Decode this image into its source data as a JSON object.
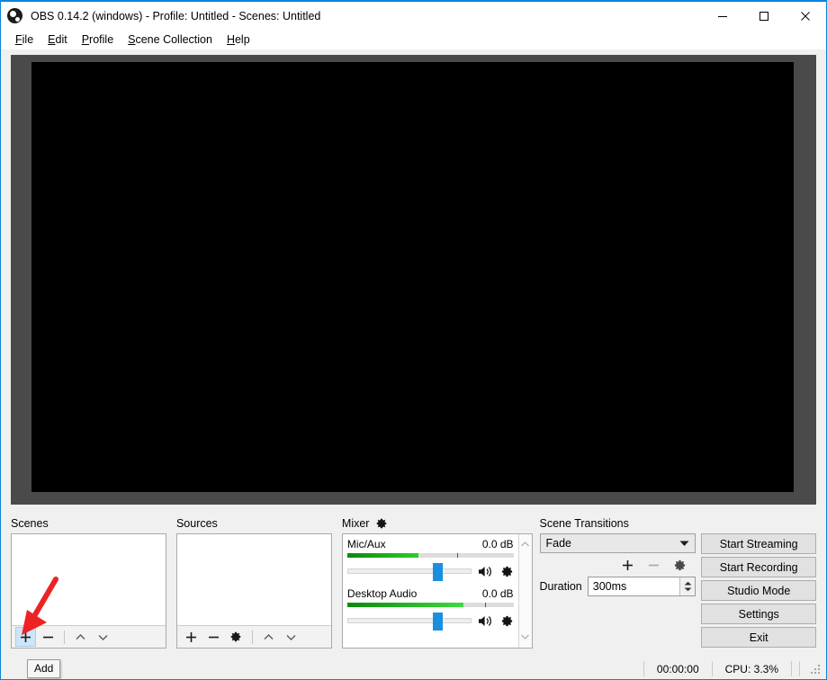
{
  "window": {
    "title": "OBS 0.14.2 (windows) - Profile: Untitled - Scenes: Untitled",
    "logo_icon": "obs-logo-icon",
    "minimize_label": "—",
    "maximize_label": "□",
    "close_label": "✕"
  },
  "menubar": {
    "items": [
      {
        "accel": "F",
        "rest": "ile"
      },
      {
        "accel": "E",
        "rest": "dit"
      },
      {
        "accel": "P",
        "rest": "rofile"
      },
      {
        "accel": "S",
        "rest": "cene Collection"
      },
      {
        "accel": "H",
        "rest": "elp"
      }
    ]
  },
  "preview": {
    "background_color": "#000000",
    "frame_color": "#4a4a4a"
  },
  "scenes": {
    "title": "Scenes",
    "items": [],
    "buttons": {
      "add": "+",
      "remove": "−",
      "up": "⌃",
      "down": "⌄"
    },
    "tooltip": "Add",
    "hovered_button": "add"
  },
  "sources": {
    "title": "Sources",
    "items": [],
    "buttons": {
      "add": "+",
      "remove": "−",
      "properties": "gear",
      "up": "⌃",
      "down": "⌄"
    }
  },
  "mixer": {
    "title": "Mixer",
    "settings_icon": "gear-icon",
    "channels": [
      {
        "name": "Mic/Aux",
        "level_db": "0.0 dB",
        "meter_percent": 43,
        "meter_tick_percent": 66,
        "slider_percent": 73,
        "meter_color_start": "#0a8a0a",
        "meter_color_end": "#2ecc2e"
      },
      {
        "name": "Desktop Audio",
        "level_db": "0.0 dB",
        "meter_percent": 70,
        "meter_tick_percent": 83,
        "slider_percent": 73,
        "meter_color_start": "#0a8a0a",
        "meter_color_end": "#3ddb3d"
      }
    ],
    "scroll_up": "⌃",
    "scroll_down": "⌄"
  },
  "scene_transitions": {
    "title": "Scene Transitions",
    "selected": "Fade",
    "options": [
      "Fade"
    ],
    "dropdown_arrow": "▼",
    "add_label": "+",
    "remove_label": "−",
    "remove_disabled": true,
    "properties_icon": "gear-icon",
    "duration_label": "Duration",
    "duration_value": "300ms",
    "spin_up": "▲",
    "spin_down": "▼"
  },
  "controls": {
    "buttons": [
      "Start Streaming",
      "Start Recording",
      "Studio Mode",
      "Settings",
      "Exit"
    ]
  },
  "statusbar": {
    "timer": "00:00:00",
    "cpu": "CPU: 3.3%"
  },
  "annotation": {
    "arrow_color": "#ee2222",
    "points_to": "scenes-add-button"
  }
}
